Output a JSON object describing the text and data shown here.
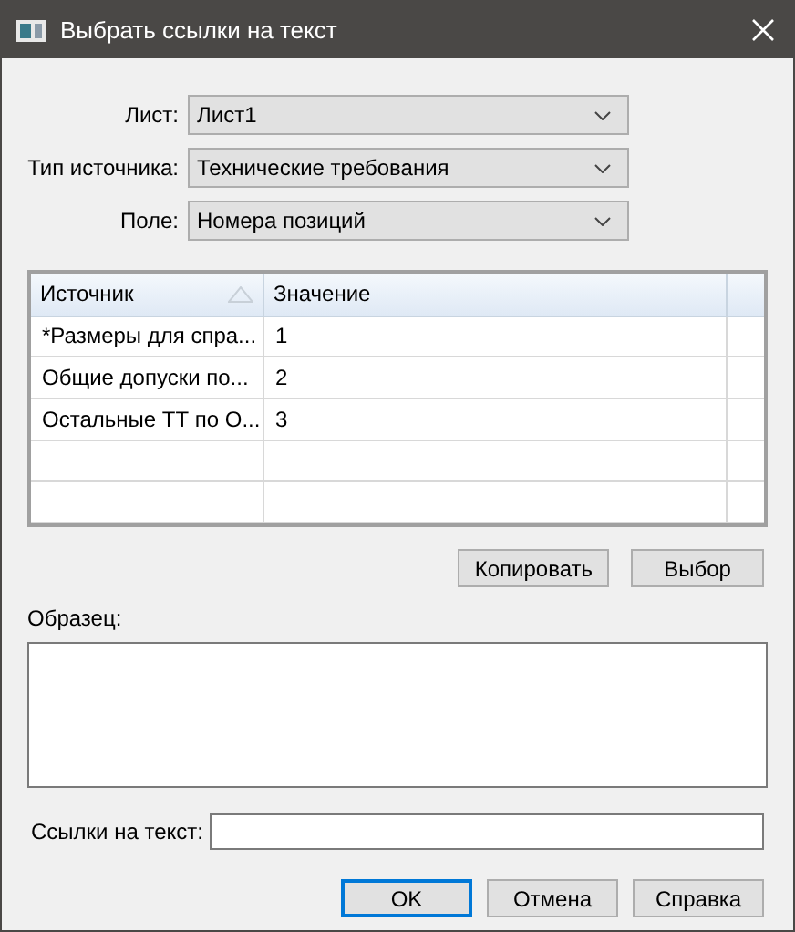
{
  "window": {
    "title": "Выбрать ссылки на текст"
  },
  "fields": [
    {
      "label": "Лист:",
      "value": "Лист1"
    },
    {
      "label": "Тип источника:",
      "value": "Технические требования"
    },
    {
      "label": "Поле:",
      "value": "Номера позиций"
    }
  ],
  "table": {
    "columns": [
      {
        "label": "Источник",
        "sorted": true
      },
      {
        "label": "Значение",
        "sorted": false
      }
    ],
    "rows": [
      [
        "*Размеры для спра...",
        "1"
      ],
      [
        "Общие допуски по...",
        "2"
      ],
      [
        "Остальные ТТ по О...",
        "3"
      ],
      [
        "",
        ""
      ],
      [
        "",
        ""
      ]
    ]
  },
  "table_buttons": [
    "Копировать",
    "Выбор"
  ],
  "sample": {
    "label": "Образец:"
  },
  "links": {
    "label": "Ссылки на текст:"
  },
  "buttons": [
    {
      "label": "OK",
      "default": true
    },
    {
      "label": "Отмена",
      "default": false
    },
    {
      "label": "Справка",
      "default": false
    }
  ]
}
